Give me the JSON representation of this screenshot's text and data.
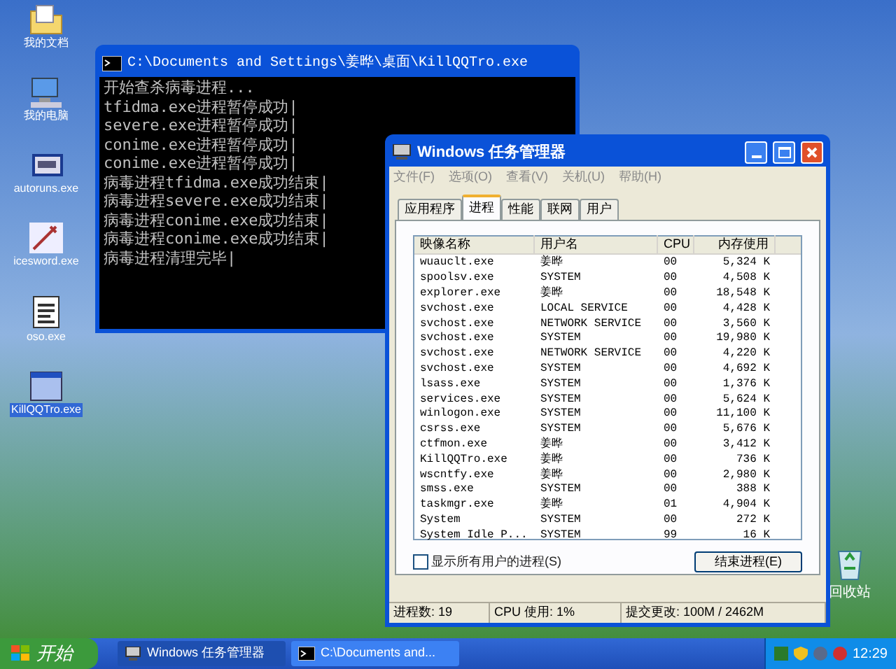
{
  "desktop_icons": [
    {
      "label": "我的文档",
      "kind": "docs",
      "selected": false
    },
    {
      "label": "我的电脑",
      "kind": "computer",
      "selected": false
    },
    {
      "label": "autoruns.exe",
      "kind": "app",
      "selected": false
    },
    {
      "label": "icesword.exe",
      "kind": "sword",
      "selected": false
    },
    {
      "label": "oso.exe",
      "kind": "notepad",
      "selected": false
    },
    {
      "label": "KillQQTro.exe",
      "kind": "window",
      "selected": true
    }
  ],
  "recycle_bin": {
    "label": "回收站"
  },
  "console": {
    "title": "C:\\Documents and Settings\\姜晔\\桌面\\KillQQTro.exe",
    "lines": [
      "开始查杀病毒进程...",
      "tfidma.exe进程暂停成功|",
      "severe.exe进程暂停成功|",
      "conime.exe进程暂停成功|",
      "conime.exe进程暂停成功|",
      "病毒进程tfidma.exe成功结束|",
      "病毒进程severe.exe成功结束|",
      "病毒进程conime.exe成功结束|",
      "病毒进程conime.exe成功结束|",
      "病毒进程清理完毕|"
    ]
  },
  "task_manager": {
    "title": "Windows 任务管理器",
    "menu": [
      "文件(F)",
      "选项(O)",
      "查看(V)",
      "关机(U)",
      "帮助(H)"
    ],
    "tabs": [
      {
        "label": "应用程序",
        "selected": false
      },
      {
        "label": "进程",
        "selected": true
      },
      {
        "label": "性能",
        "selected": false
      },
      {
        "label": "联网",
        "selected": false
      },
      {
        "label": "用户",
        "selected": false
      }
    ],
    "columns": [
      "映像名称",
      "用户名",
      "CPU",
      "内存使用"
    ],
    "rows": [
      [
        "wuauclt.exe",
        "姜晔",
        "00",
        "5,324 K"
      ],
      [
        "spoolsv.exe",
        "SYSTEM",
        "00",
        "4,508 K"
      ],
      [
        "explorer.exe",
        "姜晔",
        "00",
        "18,548 K"
      ],
      [
        "svchost.exe",
        "LOCAL SERVICE",
        "00",
        "4,428 K"
      ],
      [
        "svchost.exe",
        "NETWORK SERVICE",
        "00",
        "3,560 K"
      ],
      [
        "svchost.exe",
        "SYSTEM",
        "00",
        "19,980 K"
      ],
      [
        "svchost.exe",
        "NETWORK SERVICE",
        "00",
        "4,220 K"
      ],
      [
        "svchost.exe",
        "SYSTEM",
        "00",
        "4,692 K"
      ],
      [
        "lsass.exe",
        "SYSTEM",
        "00",
        "1,376 K"
      ],
      [
        "services.exe",
        "SYSTEM",
        "00",
        "5,624 K"
      ],
      [
        "winlogon.exe",
        "SYSTEM",
        "00",
        "11,100 K"
      ],
      [
        "csrss.exe",
        "SYSTEM",
        "00",
        "5,676 K"
      ],
      [
        "ctfmon.exe",
        "姜晔",
        "00",
        "3,412 K"
      ],
      [
        "KillQQTro.exe",
        "姜晔",
        "00",
        "736 K"
      ],
      [
        "wscntfy.exe",
        "姜晔",
        "00",
        "2,980 K"
      ],
      [
        "smss.exe",
        "SYSTEM",
        "00",
        "388 K"
      ],
      [
        "taskmgr.exe",
        "姜晔",
        "01",
        "4,904 K"
      ],
      [
        "System",
        "SYSTEM",
        "00",
        "272 K"
      ],
      [
        "System Idle P...",
        "SYSTEM",
        "99",
        "16 K"
      ]
    ],
    "show_all_users": {
      "label": "显示所有用户的进程(S)",
      "checked": false
    },
    "end_button": "结束进程(E)",
    "status_bar": [
      "进程数: 19",
      "CPU 使用: 1%",
      "提交更改: 100M / 2462M"
    ]
  },
  "taskbar": {
    "start": "开始",
    "tasks": [
      {
        "label": "Windows 任务管理器",
        "kind": "taskmgr",
        "selected": true
      },
      {
        "label": "C:\\Documents and...",
        "kind": "console",
        "selected": false
      }
    ],
    "clock": "12:29"
  }
}
